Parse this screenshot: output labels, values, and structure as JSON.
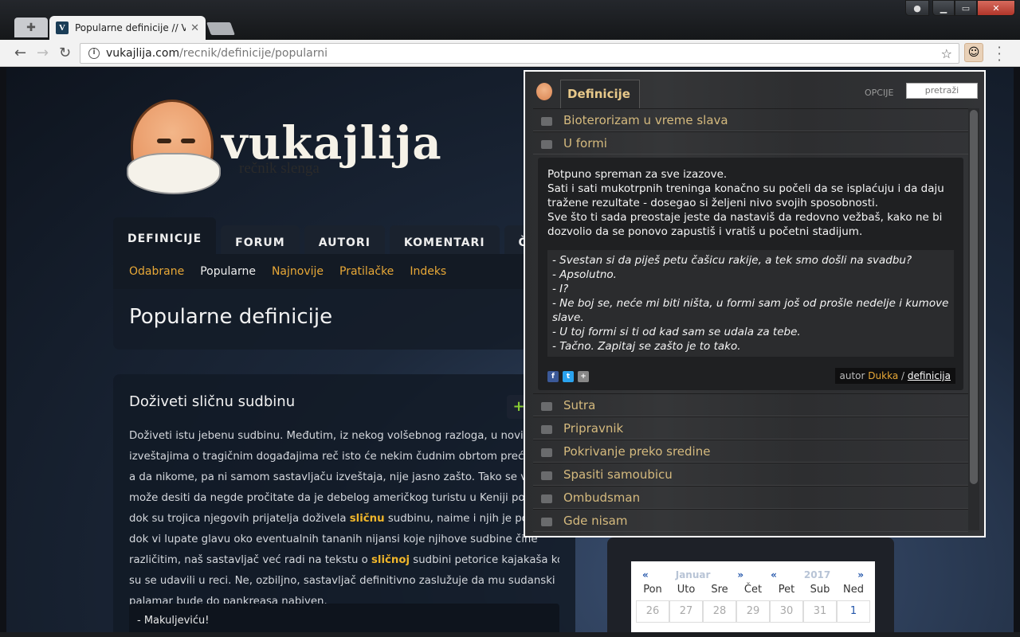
{
  "browser": {
    "tab_title": "Popularne definicije // Vukajlija",
    "tab_favicon": "V",
    "url_domain": "vukajlija.com",
    "url_path": "/recnik/definicije/popularni",
    "close_glyph": "✕",
    "star_glyph": "☆"
  },
  "site": {
    "logo_word": "vukajlija",
    "logo_sub": "rečnik slenga",
    "main_nav": [
      "DEFINICIJE",
      "FORUM",
      "AUTORI",
      "KOMENTARI",
      "ČET"
    ],
    "sub_nav": [
      "Odabrane",
      "Popularne",
      "Najnovije",
      "Pratilačke",
      "Indeks"
    ],
    "page_title": "Popularne definicije",
    "article": {
      "title": "Doživeti sličnu sudbinu",
      "add_glyph": "+",
      "lines": [
        "Doživeti istu jebenu sudbinu. Međutim, iz nekog volšebnog razloga, u novinarskim",
        "izveštajima o tragičnim događajima reč isto će nekim čudnim obrtom preći u slično,",
        "a da nikome, pa ni samom sastavljaču izveštaja, nije jasno zašto. Tako se vrlo lako",
        "može desiti da negde pročitate da je debelog američkog turistu u Keniji pojeo lav,",
        "dok su trojica njegovih prijatelja doživela sličnu sudbinu, naime i njih je pojeo lav,",
        "dok vi lupate glavu oko eventualnih tananih nijansi koje njihove sudbine čine",
        "različitim, naš sastavljač već radi na tekstu o sličnoj sudbini petorice kajakaša koji",
        "su se udavili u reci. Ne, ozbiljno, sastavljač definitivno zaslužuje da mu sudanski",
        "palamar bude do pankreasa nabiven."
      ],
      "highlight_word": "sličnu",
      "highlight_word2": "sličnoj",
      "quote": "- Makuljeviću!"
    },
    "calendar": {
      "prev": "«",
      "next": "»",
      "month": "Januar",
      "year": "2017",
      "days": [
        "Pon",
        "Uto",
        "Sre",
        "Čet",
        "Pet",
        "Sub",
        "Ned"
      ],
      "nums": [
        "26",
        "27",
        "28",
        "29",
        "30",
        "31",
        "1"
      ]
    }
  },
  "popup": {
    "tab_label": "Definicije",
    "options_label": "OPCIJE",
    "search_label": "pretraži",
    "items_top": [
      "Bioterorizam u vreme slava",
      "U formi"
    ],
    "definition_text": "Potpuno spreman za sve izazove.\nSati i sati mukotrpnih treninga konačno su počeli da se isplaćuju i da daju traženе rezultate - dosegao si željeni nivo svojih sposobnosti.\nSve što ti sada preostaje jeste da nastaviš da redovno vežbaš, kako ne bi dozvolio da se ponovo zapustiš i vratiš u početni stadijum.",
    "dialog_text": "- Svestan si da piješ petu čašicu rakije, a tek smo došli na svadbu?\n- Apsolutno.\n- I?\n- Ne boj se, neće mi biti ništa, u formi sam još od prošle nedelje i kumove slave.\n- U toj formi si ti od kad sam se udala za tebe.\n- Tačno. Zapitaj se zašto je to tako.",
    "author_prefix": "autor",
    "author_name": "Dukka",
    "author_sep": "/",
    "definition_link": "definicija",
    "items_bottom": [
      "Sutra",
      "Pripravnik",
      "Pokrivanje preko sredine",
      "Spasiti samoubicu",
      "Ombudsman",
      "Gde nisam"
    ]
  }
}
